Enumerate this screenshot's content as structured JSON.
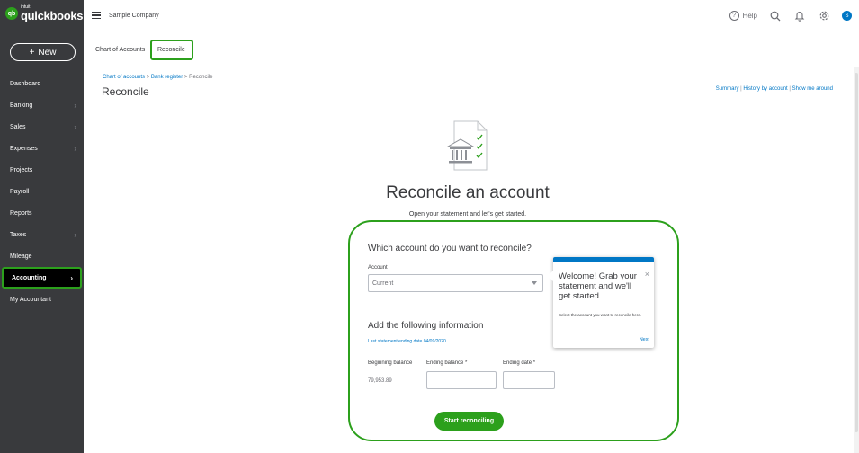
{
  "brand": {
    "logo_glyph": "qb",
    "intuit": "intuit",
    "name": "quickbooks"
  },
  "sidebar": {
    "new_label": "New",
    "new_icon": "+",
    "items": [
      {
        "label": "Dashboard",
        "chevron": ""
      },
      {
        "label": "Banking",
        "chevron": "›"
      },
      {
        "label": "Sales",
        "chevron": "›"
      },
      {
        "label": "Expenses",
        "chevron": "›"
      },
      {
        "label": "Projects",
        "chevron": ""
      },
      {
        "label": "Payroll",
        "chevron": ""
      },
      {
        "label": "Reports",
        "chevron": ""
      },
      {
        "label": "Taxes",
        "chevron": "›"
      },
      {
        "label": "Mileage",
        "chevron": ""
      },
      {
        "label": "Accounting",
        "chevron": "›",
        "active": true
      },
      {
        "label": "My Accountant",
        "chevron": ""
      }
    ]
  },
  "topbar": {
    "company": "Sample Company",
    "help_label": "Help",
    "help_glyph": "?",
    "avatar_initial": "S"
  },
  "tabs": [
    {
      "label": "Chart of Accounts"
    },
    {
      "label": "Reconcile",
      "active": true
    }
  ],
  "breadcrumb": {
    "items": [
      "Chart of accounts",
      "Bank register",
      "Reconcile"
    ],
    "separator": ">"
  },
  "page_title": "Reconcile",
  "top_links": {
    "summary": "Summary",
    "history": "History by account",
    "show_me": "Show me around",
    "separator": "|"
  },
  "hero": {
    "title": "Reconcile an account",
    "subtitle": "Open your statement and let's get started."
  },
  "form": {
    "question": "Which account do you want to reconcile?",
    "account_label": "Account",
    "account_value": "Current",
    "add_info_title": "Add the following information",
    "last_statement": "Last statement ending date 04/09/2020",
    "beginning_balance_label": "Beginning balance",
    "beginning_balance_value": "79,953.89",
    "ending_balance_label": "Ending balance *",
    "ending_date_label": "Ending date *",
    "ending_balance_value": "",
    "ending_date_value": "",
    "start_button": "Start reconciling"
  },
  "tooltip": {
    "title": "Welcome! Grab your statement and we'll get started.",
    "body": "Select the account you want to reconcile here.",
    "close": "×",
    "next": "Next"
  },
  "colors": {
    "sidebar_bg": "#393a3d",
    "brand_green": "#2ca01c",
    "link_blue": "#0077c5",
    "text": "#393a3d"
  }
}
